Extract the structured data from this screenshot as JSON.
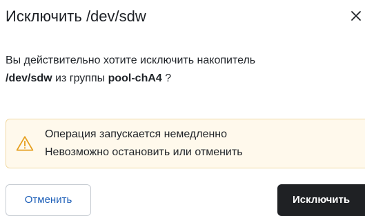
{
  "dialog": {
    "title": "Исключить /dev/sdw",
    "close_icon": "close-icon",
    "message": {
      "part1": "Вы действительно хотите исключить накопитель",
      "device": "/dev/sdw",
      "part2": " из группы ",
      "pool": "pool-chA4",
      "part3": " ?"
    },
    "alert": {
      "icon": "warning-icon",
      "line1": "Операция запускается немедленно",
      "line2": "Невозможно остановить или отменить"
    },
    "buttons": {
      "cancel_label": "Отменить",
      "confirm_label": "Исключить"
    },
    "colors": {
      "cancel_text": "#1d5fb8",
      "primary_bg": "#1f2124",
      "alert_bg": "#fff9ec",
      "alert_border": "#f1d9a3",
      "warning_icon": "#e6a020"
    }
  }
}
